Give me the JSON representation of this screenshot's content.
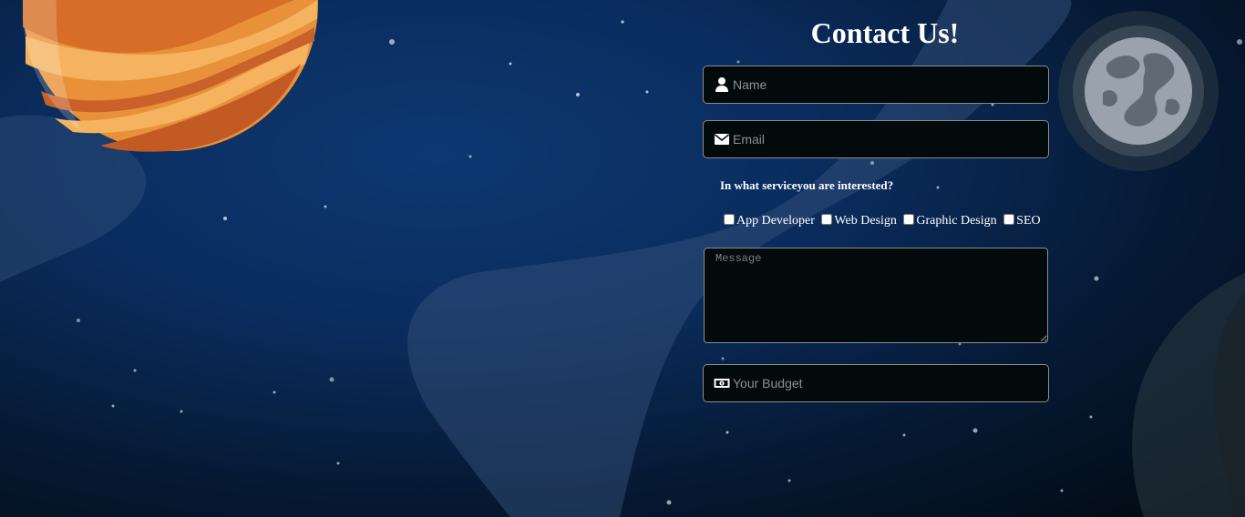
{
  "form": {
    "title": "Contact Us!",
    "name_placeholder": "Name",
    "email_placeholder": "Email",
    "service_question": "In what serviceyou are interested?",
    "services": [
      {
        "label": "App Developer"
      },
      {
        "label": "Web Design"
      },
      {
        "label": "Graphic Design"
      },
      {
        "label": "SEO"
      }
    ],
    "message_placeholder": "Message",
    "budget_placeholder": "Your Budget"
  },
  "icons": {
    "name": "user-icon",
    "email": "envelope-icon",
    "budget": "money-bill-icon"
  },
  "colors": {
    "background_deep": "#061a35",
    "background_center": "#0d3872",
    "field_background": "#030a0c",
    "field_border": "#8a8d8f",
    "planet_orange": "#e37c2c",
    "moon_gray": "#9aa3ad",
    "text": "#ffffff"
  }
}
